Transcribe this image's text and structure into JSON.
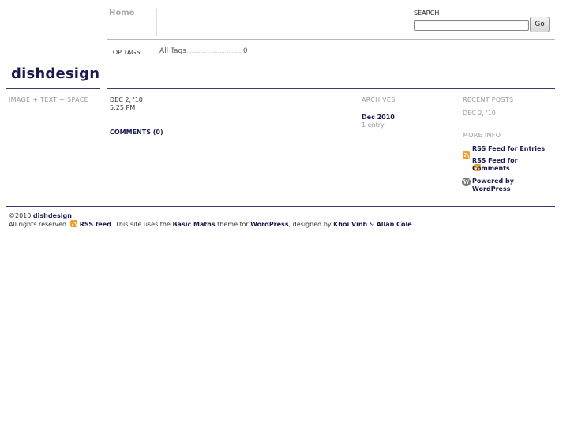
{
  "header": {
    "nav_home": "Home",
    "search_label": "SEARCH",
    "search_value": "",
    "go_label": "Go"
  },
  "tags": {
    "label": "TOP TAGS",
    "all_tags": "All Tags",
    "dots": "...............................",
    "count": "0"
  },
  "site": {
    "title": "dishdesign",
    "tagline": "IMAGE + TEXT + SPACE"
  },
  "post": {
    "date": "DEC 2, '10",
    "time": "5:25 PM",
    "comments": "COMMENTS (0)"
  },
  "archives": {
    "label": "ARCHIVES",
    "month": "Dec 2010",
    "entries": "1 entry"
  },
  "recent": {
    "label": "RECENT POSTS",
    "item": "DEC 2, '10"
  },
  "more_info": {
    "label": "MORE INFO",
    "rss_entries": "RSS Feed for Entries",
    "rss_comments_1": "RSS Feed for",
    "rss_comments_2": "Comments",
    "powered_1": "Powered by",
    "powered_2": "WordPress"
  },
  "footer": {
    "copyright": "©2010",
    "site_link": "dishdesign",
    "rights": "All rights reserved.",
    "rss_feed": "RSS feed",
    "uses": ". This site uses the",
    "theme": "Basic Maths",
    "theme_for": "theme for",
    "wordpress": "WordPress",
    "designed_by": ", designed by",
    "designer1": "Khoi Vinh",
    "amp": "&",
    "designer2": "Allan Cole",
    "end": "."
  },
  "colors": {
    "accent": "#1a1a4e",
    "rss": "#f0a030"
  }
}
